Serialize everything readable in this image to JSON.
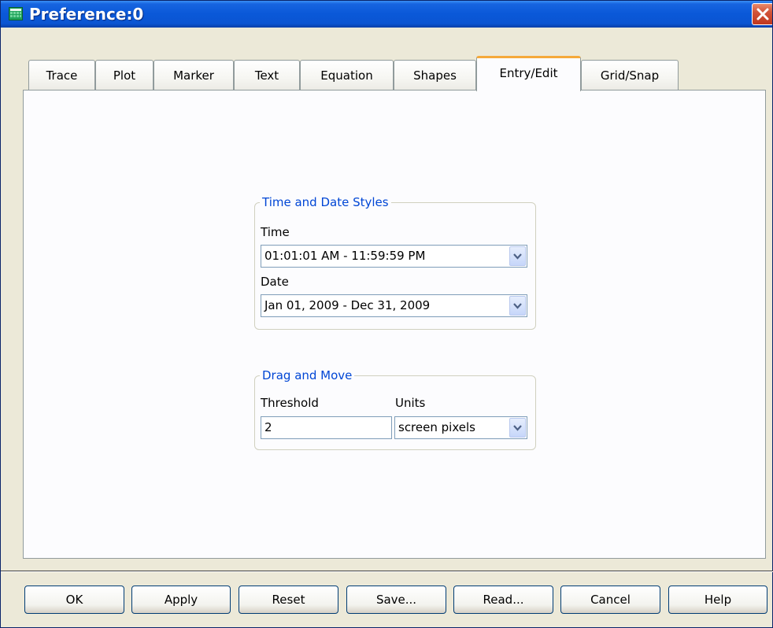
{
  "window": {
    "title": "Preference:0"
  },
  "tabs": [
    {
      "label": "Trace"
    },
    {
      "label": "Plot"
    },
    {
      "label": "Marker"
    },
    {
      "label": "Text"
    },
    {
      "label": "Equation"
    },
    {
      "label": "Shapes"
    },
    {
      "label": "Entry/Edit",
      "active": true
    },
    {
      "label": "Grid/Snap"
    }
  ],
  "time_date": {
    "legend": "Time and Date Styles",
    "time_label": "Time",
    "time_value": "01:01:01 AM - 11:59:59 PM",
    "date_label": "Date",
    "date_value": "Jan 01, 2009 - Dec 31, 2009"
  },
  "drag_move": {
    "legend": "Drag and Move",
    "threshold_label": "Threshold",
    "threshold_value": "2",
    "units_label": "Units",
    "units_value": "screen pixels"
  },
  "buttons": {
    "ok": "OK",
    "apply": "Apply",
    "reset": "Reset",
    "save": "Save...",
    "read": "Read...",
    "cancel": "Cancel",
    "help": "Help"
  },
  "colors": {
    "title_bar": "#0a58d8",
    "active_tab_accent": "#f5a93a",
    "group_legend": "#0046d5",
    "close_button": "#c0381f"
  },
  "icons": {
    "app": "grid-plot-icon",
    "close": "close-icon",
    "dropdown": "chevron-down-icon"
  }
}
